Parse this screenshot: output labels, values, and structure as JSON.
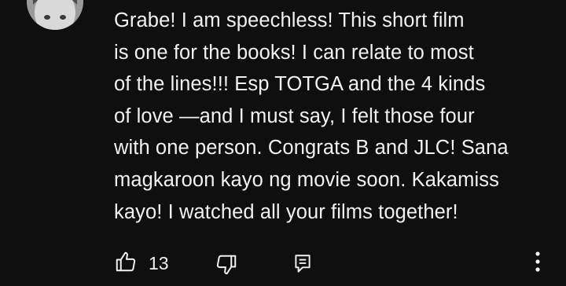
{
  "comment": {
    "text": "Grabe! I am speechless! This short film\nis one for the books! I  can relate to most\nof the lines!!! Esp TOTGA and the 4 kinds\nof love —and I must say, I felt those four\nwith one person. Congrats B and JLC! Sana\nmagkaroon kayo ng movie soon. Kakamiss\nkayo! I watched all your films together!",
    "avatar_icon": "user-avatar"
  },
  "actions": {
    "like_icon": "thumb-up-icon",
    "like_count": "13",
    "dislike_icon": "thumb-down-icon",
    "reply_icon": "reply-icon",
    "more_icon": "more-vertical-icon"
  },
  "colors": {
    "background": "#0f0f0f",
    "text": "#f1f1f1"
  }
}
